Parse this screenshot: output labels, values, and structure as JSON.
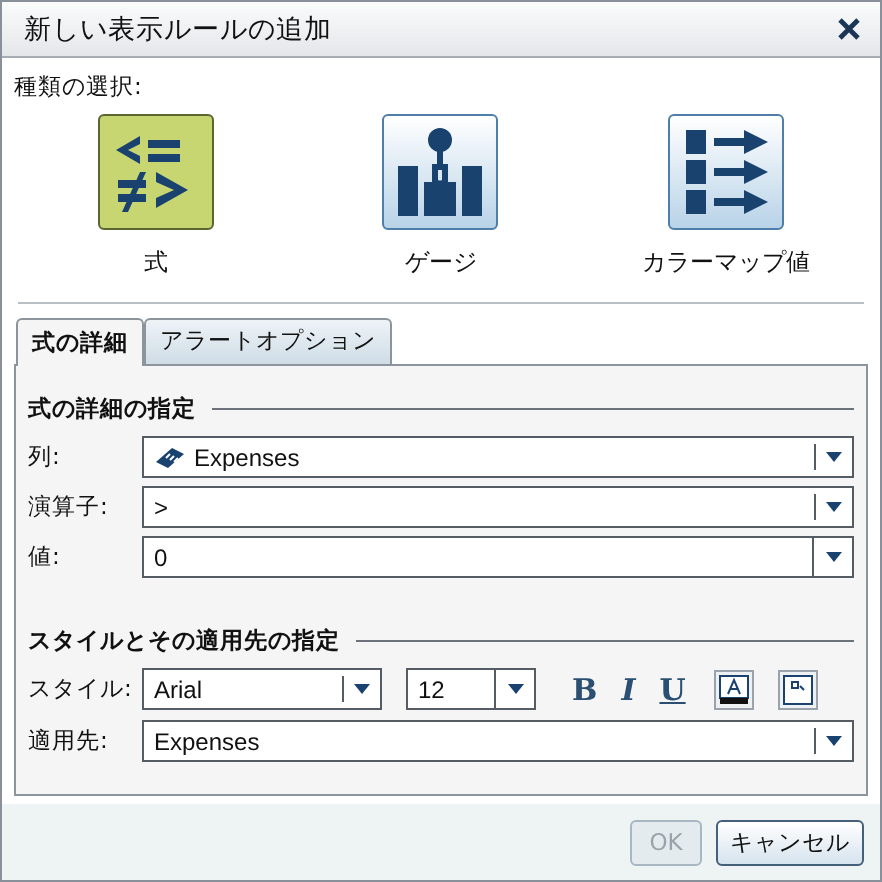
{
  "window": {
    "title": "新しい表示ルールの追加"
  },
  "type_picker": {
    "label": "種類の選択:",
    "types": [
      {
        "kind": "expression",
        "label": "式",
        "selected": true
      },
      {
        "kind": "gauge",
        "label": "ゲージ",
        "selected": false
      },
      {
        "kind": "colormap",
        "label": "カラーマップ値",
        "selected": false
      }
    ]
  },
  "tabs": [
    {
      "label": "式の詳細",
      "selected": true
    },
    {
      "label": "アラートオプション",
      "selected": false
    }
  ],
  "expression_section": {
    "heading": "式の詳細の指定",
    "fields": [
      {
        "kind": "column",
        "label": "列:",
        "value": "Expenses"
      },
      {
        "kind": "dropdown",
        "label": "演算子:",
        "value": ">"
      },
      {
        "kind": "combo",
        "label": "値:",
        "value": "0"
      }
    ]
  },
  "style_section": {
    "heading": "スタイルとその適用先の指定",
    "style_label": "スタイル:",
    "font": "Arial",
    "size": "12",
    "format_buttons": [
      {
        "kind": "bold",
        "label": "B"
      },
      {
        "kind": "italic",
        "label": "I"
      },
      {
        "kind": "underline",
        "label": "U"
      }
    ],
    "apply_label": "適用先:",
    "apply_value": "Expenses"
  },
  "buttons": [
    {
      "label": "OK",
      "disabled": true
    },
    {
      "label": "キャンセル",
      "disabled": false
    }
  ]
}
